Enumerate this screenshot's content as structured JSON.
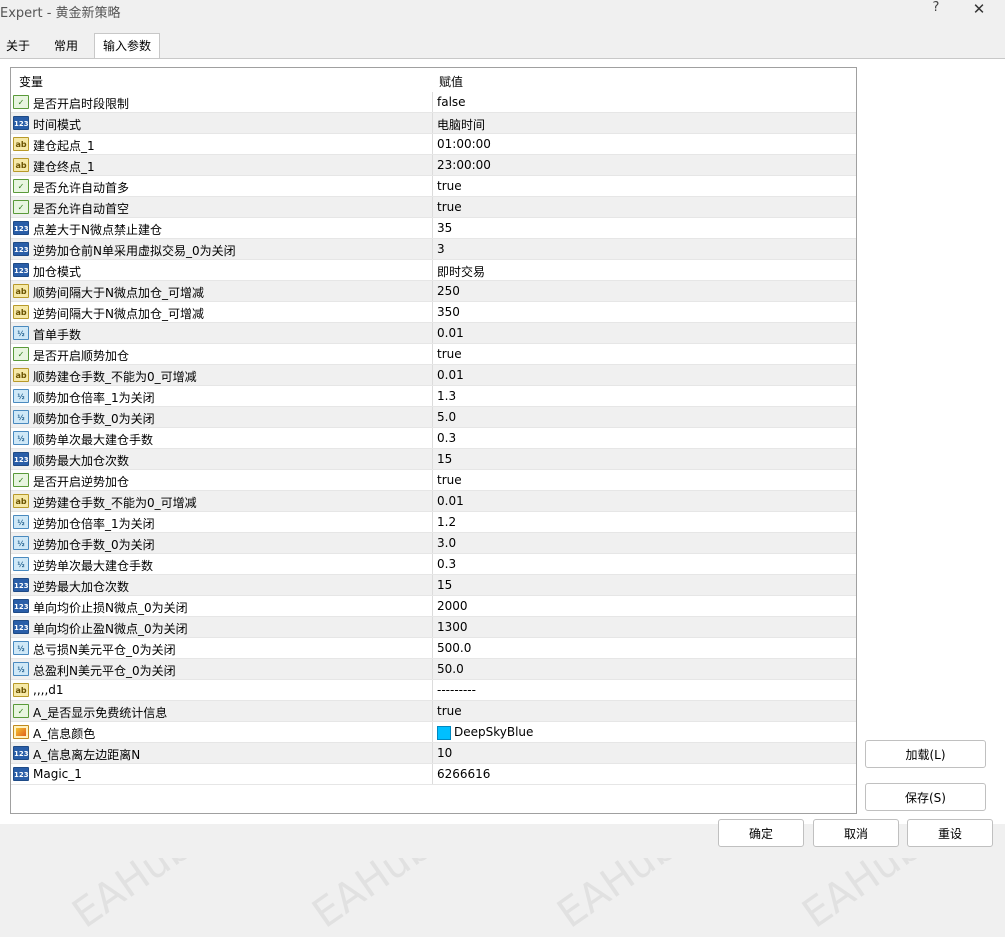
{
  "window": {
    "title": "Expert - 黄金新策略",
    "help_label": "?",
    "close_label": "✕"
  },
  "tabs": [
    {
      "label": "关于"
    },
    {
      "label": "常用"
    },
    {
      "label": "输入参数",
      "active": true
    }
  ],
  "grid": {
    "col_variable": "变量",
    "col_value": "赋值",
    "rows": [
      {
        "type": "bool",
        "name": "是否开启时段限制",
        "value": "false"
      },
      {
        "type": "int",
        "name": "时间模式",
        "value": "电脑时间"
      },
      {
        "type": "str",
        "name": "建仓起点_1",
        "value": "01:00:00"
      },
      {
        "type": "str",
        "name": "建仓终点_1",
        "value": "23:00:00"
      },
      {
        "type": "bool",
        "name": "是否允许自动首多",
        "value": "true"
      },
      {
        "type": "bool",
        "name": "是否允许自动首空",
        "value": "true"
      },
      {
        "type": "int",
        "name": "点差大于N微点禁止建仓",
        "value": "35"
      },
      {
        "type": "int",
        "name": "逆势加仓前N单采用虚拟交易_0为关闭",
        "value": "3"
      },
      {
        "type": "int",
        "name": "加仓模式",
        "value": "即时交易"
      },
      {
        "type": "str",
        "name": "顺势间隔大于N微点加仓_可增减",
        "value": "250"
      },
      {
        "type": "str",
        "name": "逆势间隔大于N微点加仓_可增减",
        "value": "350"
      },
      {
        "type": "dbl",
        "name": "首单手数",
        "value": "0.01"
      },
      {
        "type": "bool",
        "name": "是否开启顺势加仓",
        "value": "true"
      },
      {
        "type": "str",
        "name": "顺势建仓手数_不能为0_可增减",
        "value": "0.01"
      },
      {
        "type": "dbl",
        "name": "顺势加仓倍率_1为关闭",
        "value": "1.3"
      },
      {
        "type": "dbl",
        "name": "顺势加仓手数_0为关闭",
        "value": "5.0"
      },
      {
        "type": "dbl",
        "name": "顺势单次最大建仓手数",
        "value": "0.3"
      },
      {
        "type": "int",
        "name": "顺势最大加仓次数",
        "value": "15"
      },
      {
        "type": "bool",
        "name": "是否开启逆势加仓",
        "value": "true"
      },
      {
        "type": "str",
        "name": "逆势建仓手数_不能为0_可增减",
        "value": "0.01"
      },
      {
        "type": "dbl",
        "name": "逆势加仓倍率_1为关闭",
        "value": "1.2"
      },
      {
        "type": "dbl",
        "name": "逆势加仓手数_0为关闭",
        "value": "3.0"
      },
      {
        "type": "dbl",
        "name": "逆势单次最大建仓手数",
        "value": "0.3"
      },
      {
        "type": "int",
        "name": "逆势最大加仓次数",
        "value": "15"
      },
      {
        "type": "int",
        "name": "单向均价止损N微点_0为关闭",
        "value": "2000"
      },
      {
        "type": "int",
        "name": "单向均价止盈N微点_0为关闭",
        "value": "1300"
      },
      {
        "type": "dbl",
        "name": "总亏损N美元平仓_0为关闭",
        "value": "500.0"
      },
      {
        "type": "dbl",
        "name": "总盈利N美元平仓_0为关闭",
        "value": "50.0"
      },
      {
        "type": "str",
        "name": ",,,,d1",
        "value": "---------"
      },
      {
        "type": "bool",
        "name": "A_是否显示免费统计信息",
        "value": "true"
      },
      {
        "type": "color",
        "name": "A_信息颜色",
        "value": "DeepSkyBlue",
        "swatch": "#00bfff"
      },
      {
        "type": "int",
        "name": "A_信息离左边距离N",
        "value": "10"
      },
      {
        "type": "int",
        "name": "Magic_1",
        "value": "6266616"
      }
    ]
  },
  "icon_glyphs": {
    "bool": "✓",
    "int": "123",
    "str": "ab",
    "dbl": "½",
    "color": ""
  },
  "buttons": {
    "load": "加载(L)",
    "save": "保存(S)",
    "ok": "确定",
    "cancel": "取消",
    "reset": "重设"
  },
  "watermark": "EAHub.cn"
}
